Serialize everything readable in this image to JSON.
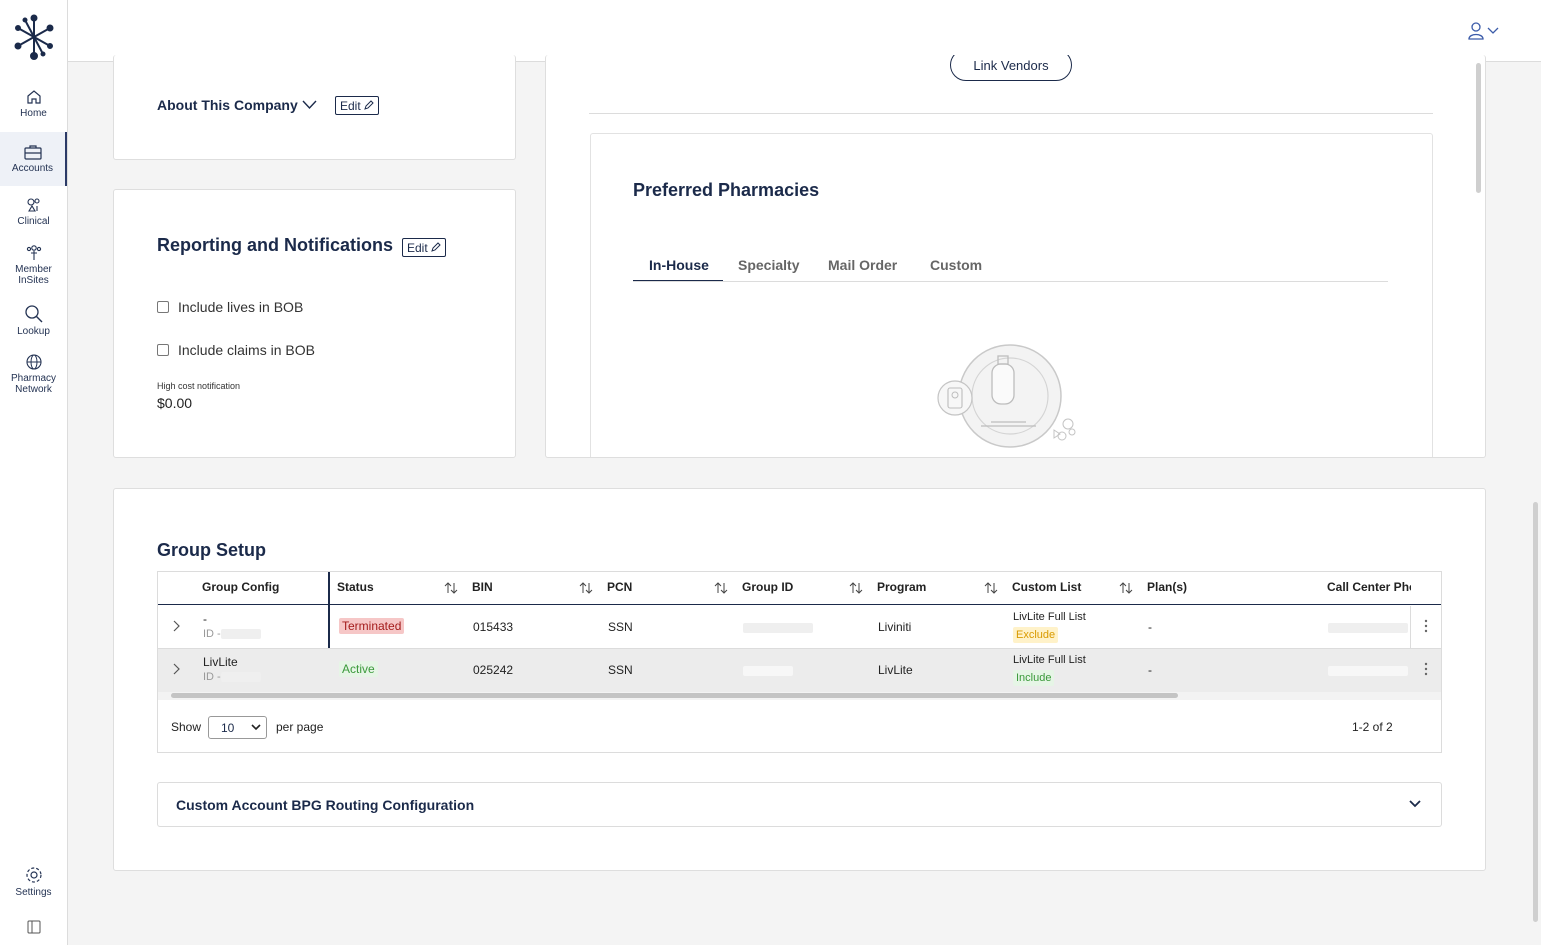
{
  "nav": {
    "items": [
      {
        "label": "Home",
        "icon": "home-icon"
      },
      {
        "label": "Accounts",
        "icon": "briefcase-icon",
        "active": true
      },
      {
        "label": "Clinical",
        "icon": "clinical-icon"
      },
      {
        "label": "Member InSites",
        "icon": "member-icon"
      },
      {
        "label": "Lookup",
        "icon": "search-icon"
      },
      {
        "label": "Pharmacy Network",
        "icon": "globe-icon"
      },
      {
        "label": "Settings",
        "icon": "gear-icon"
      }
    ]
  },
  "about": {
    "title": "About This Company",
    "edit_label": "Edit"
  },
  "reporting": {
    "title": "Reporting and Notifications",
    "edit_label": "Edit",
    "checkbox_lives": "Include lives in BOB",
    "checkbox_claims": "Include claims in BOB",
    "high_cost_label": "High cost notification",
    "high_cost_value": "$0.00"
  },
  "vendors": {
    "link_label": "Link Vendors"
  },
  "pharmacies": {
    "title": "Preferred Pharmacies",
    "tabs": [
      "In-House",
      "Specialty",
      "Mail Order",
      "Custom"
    ],
    "active_tab": "In-House"
  },
  "group_setup": {
    "title": "Group Setup",
    "columns": [
      "Group Config",
      "Status",
      "BIN",
      "PCN",
      "Group ID",
      "Program",
      "Custom List",
      "Plan(s)",
      "Call Center Phor"
    ],
    "rows": [
      {
        "name": "-",
        "id_label": "ID -",
        "status": "Terminated",
        "bin": "015433",
        "pcn": "SSN",
        "program": "Liviniti",
        "custom_list": "LivLite Full List",
        "custom_flag": "Exclude",
        "plans": "-"
      },
      {
        "name": "LivLite",
        "id_label": "ID -",
        "status": "Active",
        "bin": "025242",
        "pcn": "SSN",
        "program": "LivLite",
        "custom_list": "LivLite Full List",
        "custom_flag": "Include",
        "plans": "-"
      }
    ],
    "show_label": "Show",
    "per_page_value": "10",
    "per_page_label": "per page",
    "pagination": "1-2 of 2"
  },
  "routing": {
    "title": "Custom Account BPG Routing Configuration"
  }
}
